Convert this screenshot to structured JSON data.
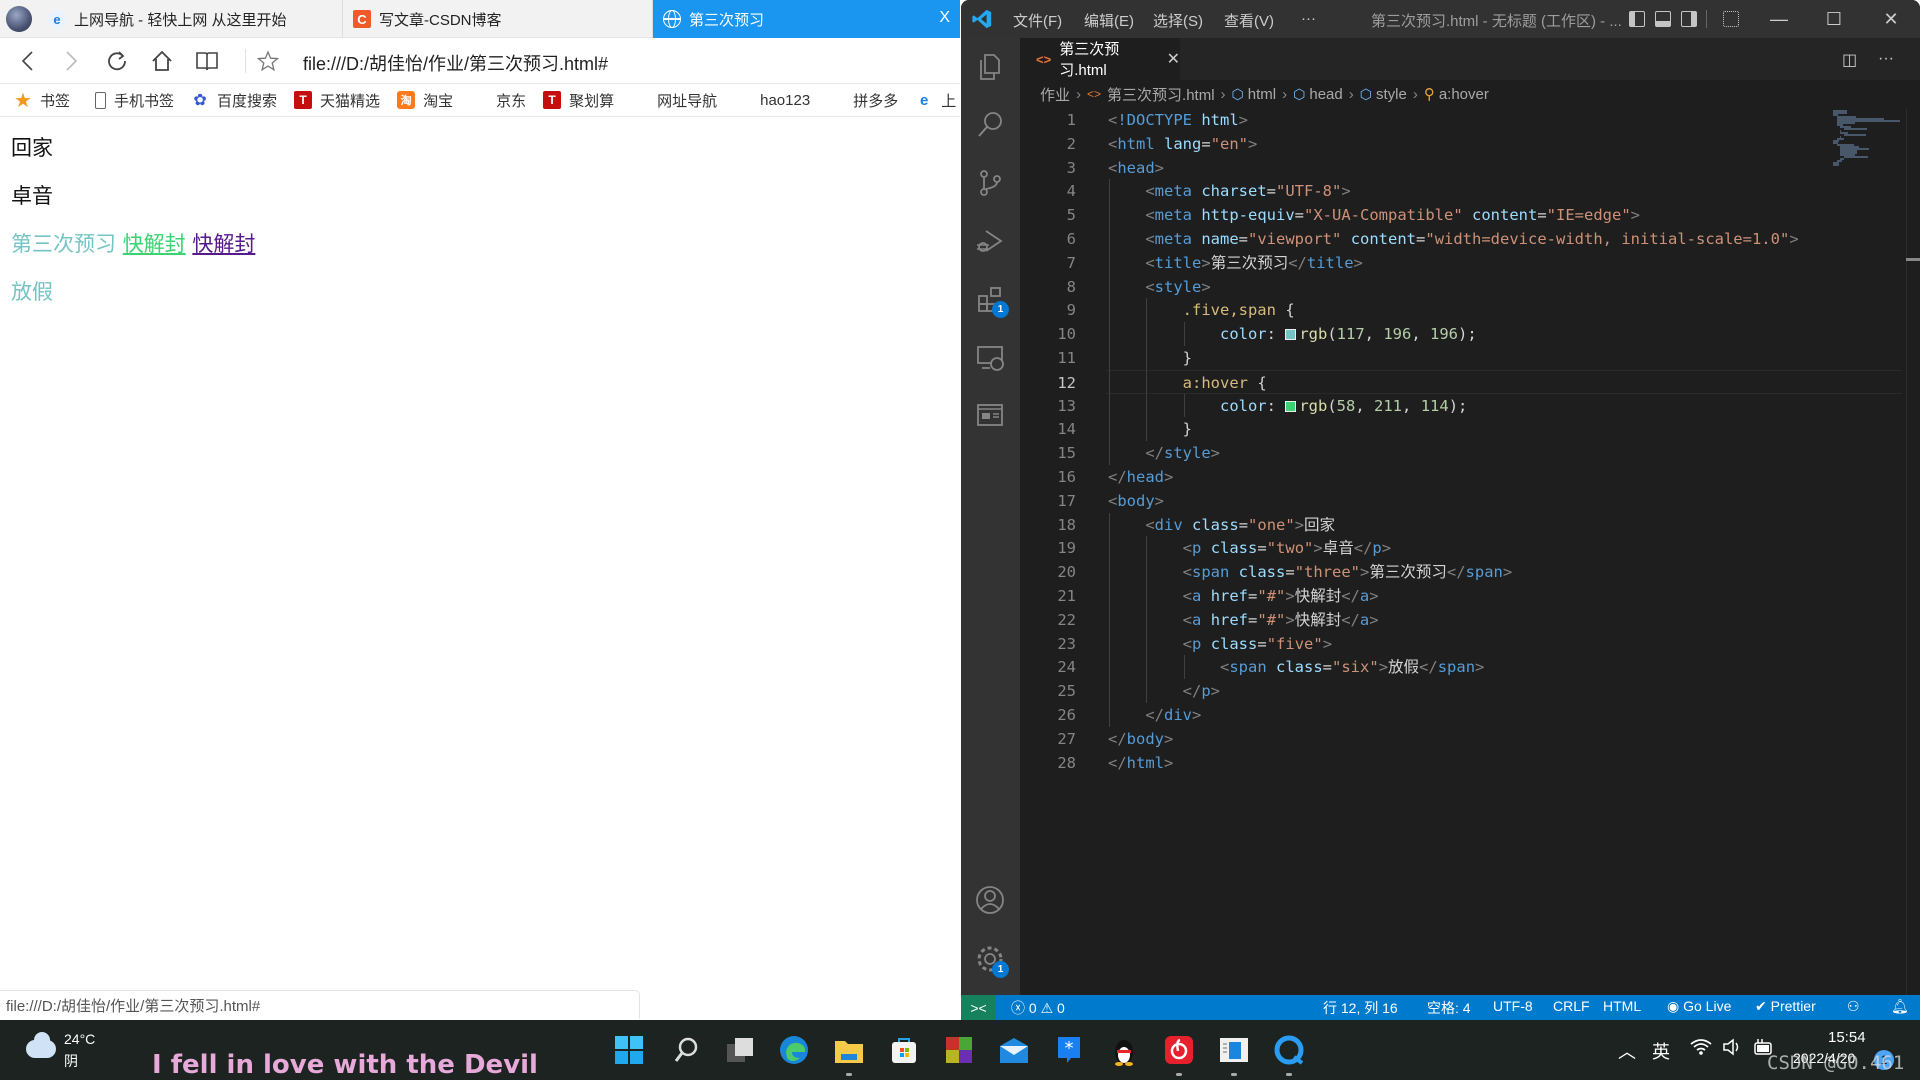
{
  "browser": {
    "tabs": [
      {
        "label": "上网导航 - 轻快上网 从这里开始",
        "icon": "ie-icon"
      },
      {
        "label": "写文章-CSDN博客",
        "icon": "csdn-icon"
      },
      {
        "label": "第三次预习",
        "icon": "globe-icon",
        "active": true
      }
    ],
    "tab_close": "X",
    "url": "file:///D:/胡佳怡/作业/第三次预习.html#",
    "bookmarks": [
      {
        "label": "书签",
        "icon": "star-icon"
      },
      {
        "label": "手机书签",
        "icon": "phone-icon"
      },
      {
        "label": "百度搜索",
        "icon": "baidu-paw-icon"
      },
      {
        "label": "天猫精选",
        "icon": "tmall-icon"
      },
      {
        "label": "淘宝",
        "icon": "taobao-icon"
      },
      {
        "label": "京东",
        "icon": "globe-icon"
      },
      {
        "label": "聚划算",
        "icon": "juhuasuan-icon"
      },
      {
        "label": "网址导航",
        "icon": "globe-icon"
      },
      {
        "label": "hao123",
        "icon": "globe-icon"
      },
      {
        "label": "拼多多",
        "icon": "globe-icon"
      },
      {
        "label": "上",
        "icon": "ie-icon"
      }
    ],
    "page": {
      "line1": "回家",
      "line2": "卓音",
      "span_three": "第三次预习",
      "link1": "快解封",
      "link2": "快解封",
      "line4": "放假",
      "colors": {
        "teal": "#75c4c4",
        "hover_green": "#3ad372",
        "visited": "#551a8b"
      }
    },
    "status_url": "file:///D:/胡佳怡/作业/第三次预习.html#"
  },
  "vscode": {
    "menu": [
      "文件(F)",
      "编辑(E)",
      "选择(S)",
      "查看(V)",
      "···"
    ],
    "window_title": "第三次预习.html - 无标题 (工作区) - ...",
    "editor_tab": {
      "label": "第三次预习.html",
      "close": "✕"
    },
    "breadcrumb": [
      "作业",
      "第三次预习.html",
      "html",
      "head",
      "style",
      "a:hover"
    ],
    "code_lines": [
      "<!DOCTYPE html>",
      "<html lang=\"en\">",
      "<head>",
      "    <meta charset=\"UTF-8\">",
      "    <meta http-equiv=\"X-UA-Compatible\" content=\"IE=edge\">",
      "    <meta name=\"viewport\" content=\"width=device-width, initial-scale=1.0\">",
      "    <title>第三次预习</title>",
      "    <style>",
      "        .five,span {",
      "            color: rgb(117, 196, 196);",
      "        }",
      "        a:hover {",
      "            color: rgb(58, 211, 114);",
      "        }",
      "    </style>",
      "</head>",
      "<body>",
      "    <div class=\"one\">回家",
      "        <p class=\"two\">卓音</p>",
      "        <span class=\"three\">第三次预习</span>",
      "        <a href=\"#\">快解封</a>",
      "        <a href=\"#\">快解封</a>",
      "        <p class=\"five\">",
      "            <span class=\"six\">放假</span>",
      "        </p>",
      "    </div>",
      "</body>",
      "</html>"
    ],
    "active_line": 12,
    "activity_badges": {
      "extensions": "1",
      "settings": "1"
    },
    "statusbar": {
      "errors": "0",
      "warnings": "0",
      "position": "行 12, 列 16",
      "spaces": "空格: 4",
      "encoding": "UTF-8",
      "eol": "CRLF",
      "language": "HTML",
      "golive": "Go Live",
      "prettier": "Prettier"
    }
  },
  "taskbar": {
    "weather_temp": "24°C",
    "weather_cond": "阴",
    "lyric": "I fell in love with the Devil",
    "apps": [
      "start",
      "search",
      "task-view",
      "edge",
      "file-explorer",
      "store",
      "app-grid",
      "mail",
      "dingtalk",
      "qq",
      "netease-music",
      "notepad-app",
      "qq-browser"
    ],
    "ime": "英",
    "time": "15:54",
    "date": "2022/4/20",
    "notifications": "1",
    "watermark": "CSDN @G0.461"
  }
}
